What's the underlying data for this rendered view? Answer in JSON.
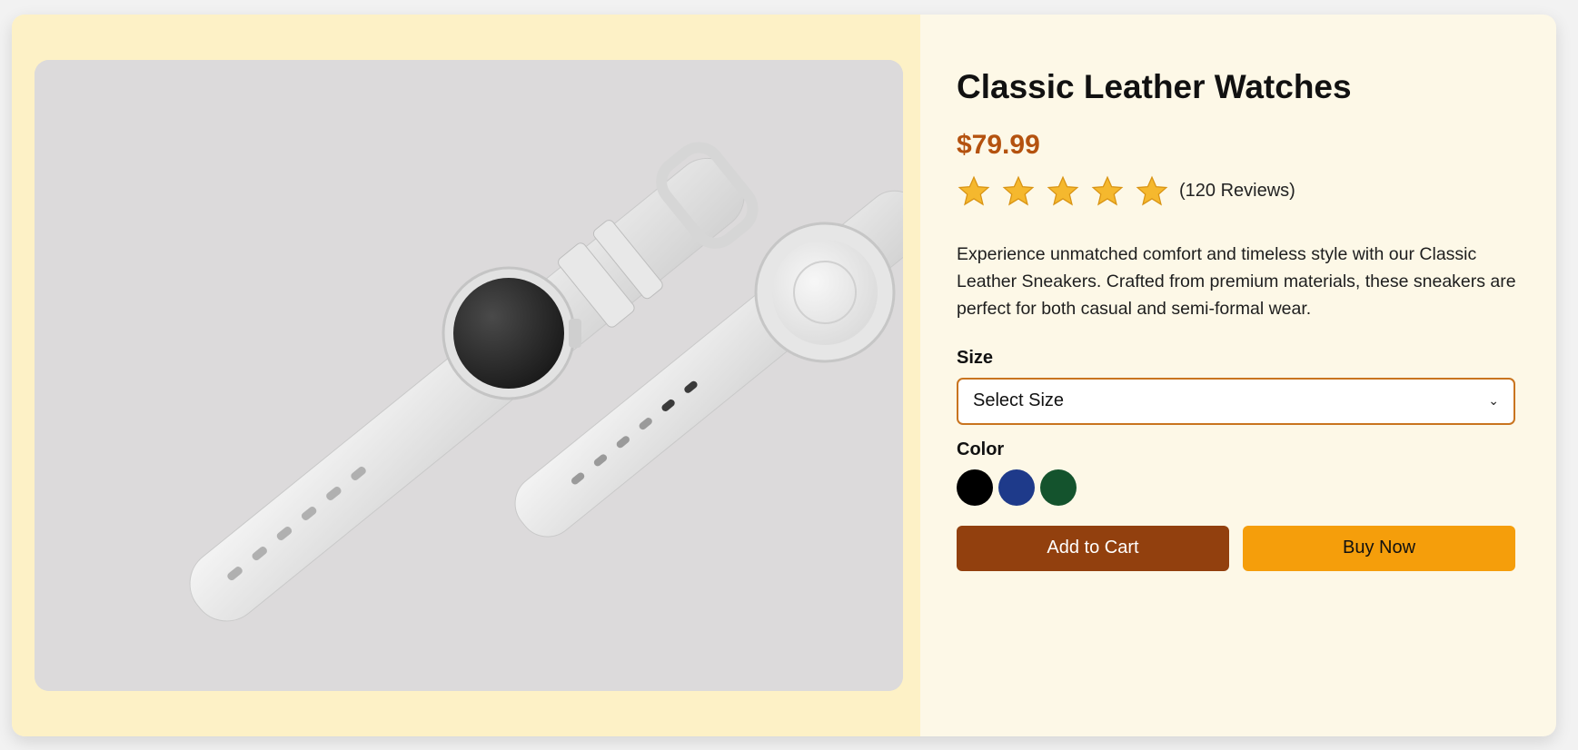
{
  "product": {
    "title": "Classic Leather Watches",
    "price": "$79.99",
    "rating": 5,
    "max_rating": 5,
    "review_count": "(120 Reviews)",
    "description": "Experience unmatched comfort and timeless style with our Classic Leather Sneakers. Crafted from premium materials, these sneakers are perfect for both casual and semi-formal wear.",
    "image_icon": "product-image-white-smartwatches"
  },
  "size": {
    "label": "Size",
    "selected": "Select Size"
  },
  "color": {
    "label": "Color",
    "options": [
      "#000000",
      "#1e3a8a",
      "#14532d"
    ]
  },
  "actions": {
    "add_to_cart": "Add to Cart",
    "buy_now": "Buy Now"
  },
  "theme": {
    "accent": "#b4520f",
    "cart_button": "#92400e",
    "buy_button": "#f59e0b",
    "star": "#f5b82e"
  }
}
